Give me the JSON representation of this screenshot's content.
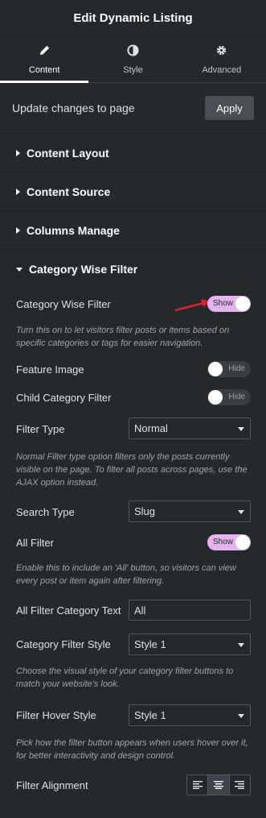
{
  "header": {
    "title": "Edit Dynamic Listing"
  },
  "tabs": [
    {
      "label": "Content",
      "icon": "pencil-icon"
    },
    {
      "label": "Style",
      "icon": "contrast-icon"
    },
    {
      "label": "Advanced",
      "icon": "gear-icon"
    }
  ],
  "update": {
    "text": "Update changes to page",
    "button": "Apply"
  },
  "sections": {
    "content_layout": "Content Layout",
    "content_source": "Content Source",
    "columns_manage": "Columns Manage",
    "category_wise_filter": "Category Wise Filter"
  },
  "controls": {
    "category_wise_filter": {
      "label": "Category Wise Filter",
      "toggle": "Show",
      "description": "Turn this on to let visitors filter posts or items based on specific categories or tags for easier navigation."
    },
    "feature_image": {
      "label": "Feature Image",
      "toggle": "Hide"
    },
    "child_category_filter": {
      "label": "Child Category Filter",
      "toggle": "Hide"
    },
    "filter_type": {
      "label": "Filter Type",
      "value": "Normal",
      "description": "Normal Filter type option filters only the posts currently visible on the page. To filter all posts across pages, use the AJAX option instead."
    },
    "search_type": {
      "label": "Search Type",
      "value": "Slug"
    },
    "all_filter": {
      "label": "All Filter",
      "toggle": "Show",
      "description": "Enable this to include an 'All' button, so visitors can view every post or item again after filtering."
    },
    "all_filter_category_text": {
      "label": "All Filter Category Text",
      "value": "All"
    },
    "category_filter_style": {
      "label": "Category Filter Style",
      "value": "Style 1",
      "description": "Choose the visual style of your category filter buttons to match your website's look."
    },
    "filter_hover_style": {
      "label": "Filter Hover Style",
      "value": "Style 1",
      "description": "Pick how the filter button appears when users hover over it, for better interactivity and design control."
    },
    "filter_alignment": {
      "label": "Filter Alignment",
      "selected": "center"
    }
  },
  "colors": {
    "background": "#26292c",
    "toggle_on": "#e5b4ee",
    "arrow": "#e0202a"
  }
}
